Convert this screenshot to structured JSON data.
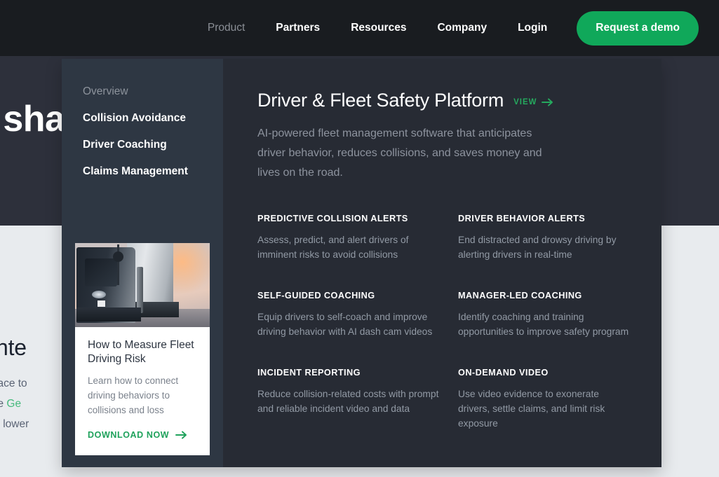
{
  "topnav": {
    "links": [
      {
        "label": "Product",
        "active": true
      },
      {
        "label": "Partners",
        "active": false
      },
      {
        "label": "Resources",
        "active": false
      },
      {
        "label": "Company",
        "active": false
      },
      {
        "label": "Login",
        "active": false
      }
    ],
    "cta_label": "Request a demo",
    "cta_color": "#10a85a"
  },
  "background": {
    "hero_headline": "a sha",
    "section_title": "es inte",
    "section_body_line1": "interface to",
    "section_body_line2_pre": " on the ",
    "section_body_line2_link": "Ge",
    "section_body_line3": "k and lower",
    "link_color": "#45b97c"
  },
  "megamenu": {
    "rail": {
      "items": [
        {
          "label": "Overview",
          "dim": true
        },
        {
          "label": "Collision Avoidance",
          "dim": false
        },
        {
          "label": "Driver Coaching",
          "dim": false
        },
        {
          "label": "Claims Management",
          "dim": false
        }
      ],
      "promo": {
        "image_alt": "semi-truck-photo",
        "title": "How to Measure Fleet Driving Risk",
        "description": "Learn how to connect driving behaviors to collisions and loss",
        "link_label": "DOWNLOAD NOW",
        "link_color": "#1fa25c"
      }
    },
    "content": {
      "title": "Driver & Fleet Safety Platform",
      "view_label": "VIEW",
      "view_color": "#25a95e",
      "subtitle": "AI-powered fleet management software that anticipates driver behavior, reduces collisions, and saves money and lives on the road.",
      "features": [
        {
          "heading": "PREDICTIVE COLLISION ALERTS",
          "description": "Assess, predict, and alert drivers of imminent risks to avoid collisions"
        },
        {
          "heading": "DRIVER BEHAVIOR ALERTS",
          "description": "End distracted and drowsy driving by alerting drivers in real-time"
        },
        {
          "heading": "SELF-GUIDED COACHING",
          "description": "Equip drivers to self-coach and improve driving behavior with AI dash cam videos"
        },
        {
          "heading": "MANAGER-LED COACHING",
          "description": "Identify coaching and training opportunities to improve safety program"
        },
        {
          "heading": "INCIDENT REPORTING",
          "description": "Reduce collision-related costs with prompt and reliable incident video and data"
        },
        {
          "heading": "ON-DEMAND VIDEO",
          "description": "Use video evidence to exonerate drivers, settle claims, and limit risk exposure"
        }
      ]
    }
  }
}
